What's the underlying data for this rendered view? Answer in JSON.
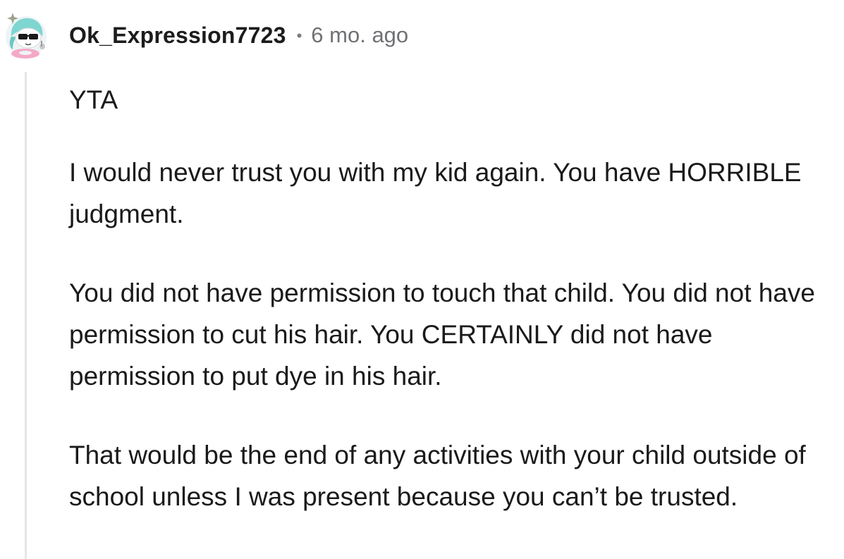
{
  "comment": {
    "author": "Ok_Expression7723",
    "separator": "•",
    "timestamp": "6 mo. ago",
    "avatar_icon": "snoo-avatar-sunglasses-icon",
    "paragraphs": [
      "YTA",
      "I would never trust you with my kid again. You have HORRIBLE judgment.",
      "You did not have permission to touch that child. You did not have permission to cut his hair. You CERTAINLY did not have permission to put dye in his hair.",
      "That would be the end of any activities with your child outside of school unless I was present because you can’t be trusted."
    ]
  },
  "colors": {
    "text": "#1a1a1b",
    "meta": "#6f7174",
    "thread_line": "#e6e6e6",
    "avatar_hair": "#7fd6d0",
    "avatar_float": "#f4a9c6"
  }
}
